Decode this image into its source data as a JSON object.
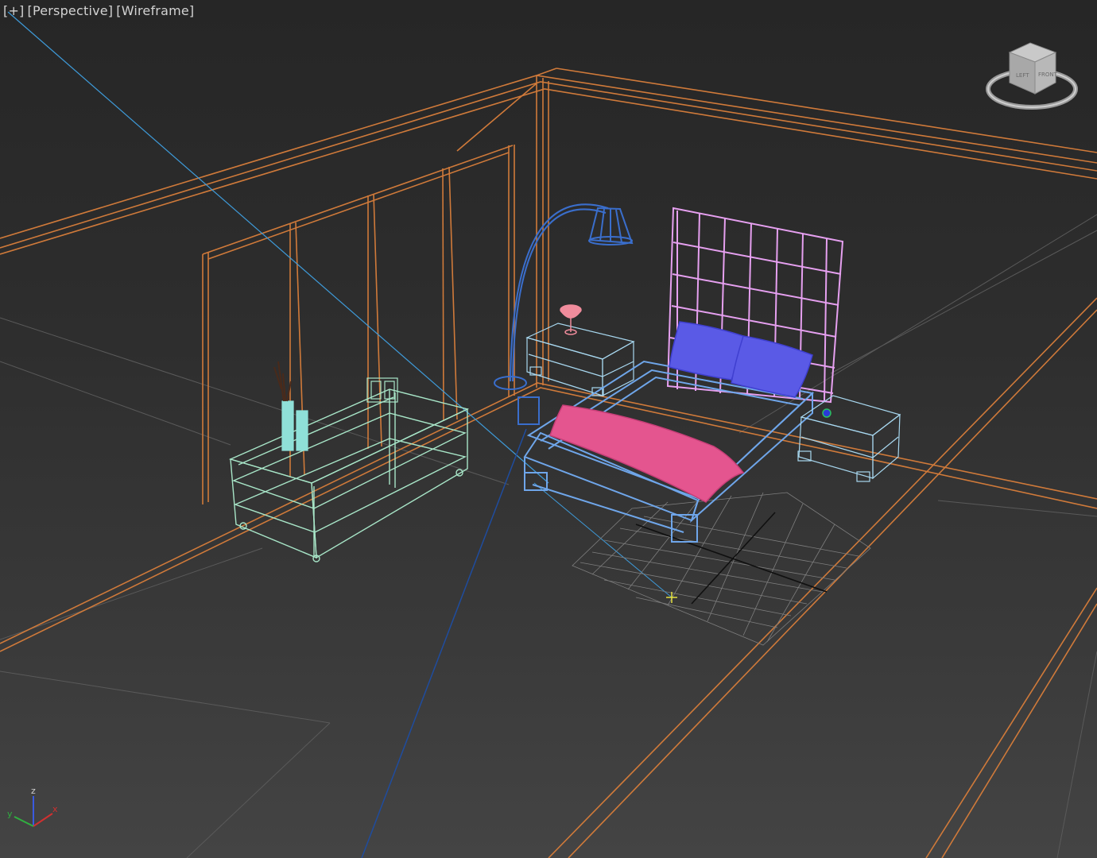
{
  "viewport": {
    "labels": {
      "menu": "[+]",
      "view": "[Perspective]",
      "shading": "[Wireframe]"
    },
    "viewcube": {
      "faces": [
        "LEFT",
        "FRONT"
      ],
      "icon": "viewcube-icon"
    },
    "axis_triad": {
      "z": "z",
      "y": "y",
      "x": "x"
    }
  },
  "colors": {
    "walls": "#d07a3a",
    "grid": "#8a8a8a",
    "cabinet": "#a8e6c8",
    "vase": "#8fe0d8",
    "branches": "#4a2a1a",
    "lamp": "#3a6ecc",
    "nightstand": "#a8d8f0",
    "bed_frame": "#6fa6ea",
    "headboard": "#e6a0f0",
    "pillows": "#5a5ae6",
    "blanket": "#e4558f",
    "small_lamp": "#f08c9c",
    "camera_line": "#3e9ad8",
    "target_line": "#1f4c9e",
    "target_marker": "#e4e040"
  },
  "scene_objects": [
    "room-walls",
    "glass-cabinet",
    "vase",
    "picture-frame",
    "arc-floor-lamp",
    "nightstand-left",
    "table-lamp",
    "bed",
    "headboard",
    "pillows",
    "blanket",
    "nightstand-right",
    "home-grid",
    "camera-target"
  ]
}
